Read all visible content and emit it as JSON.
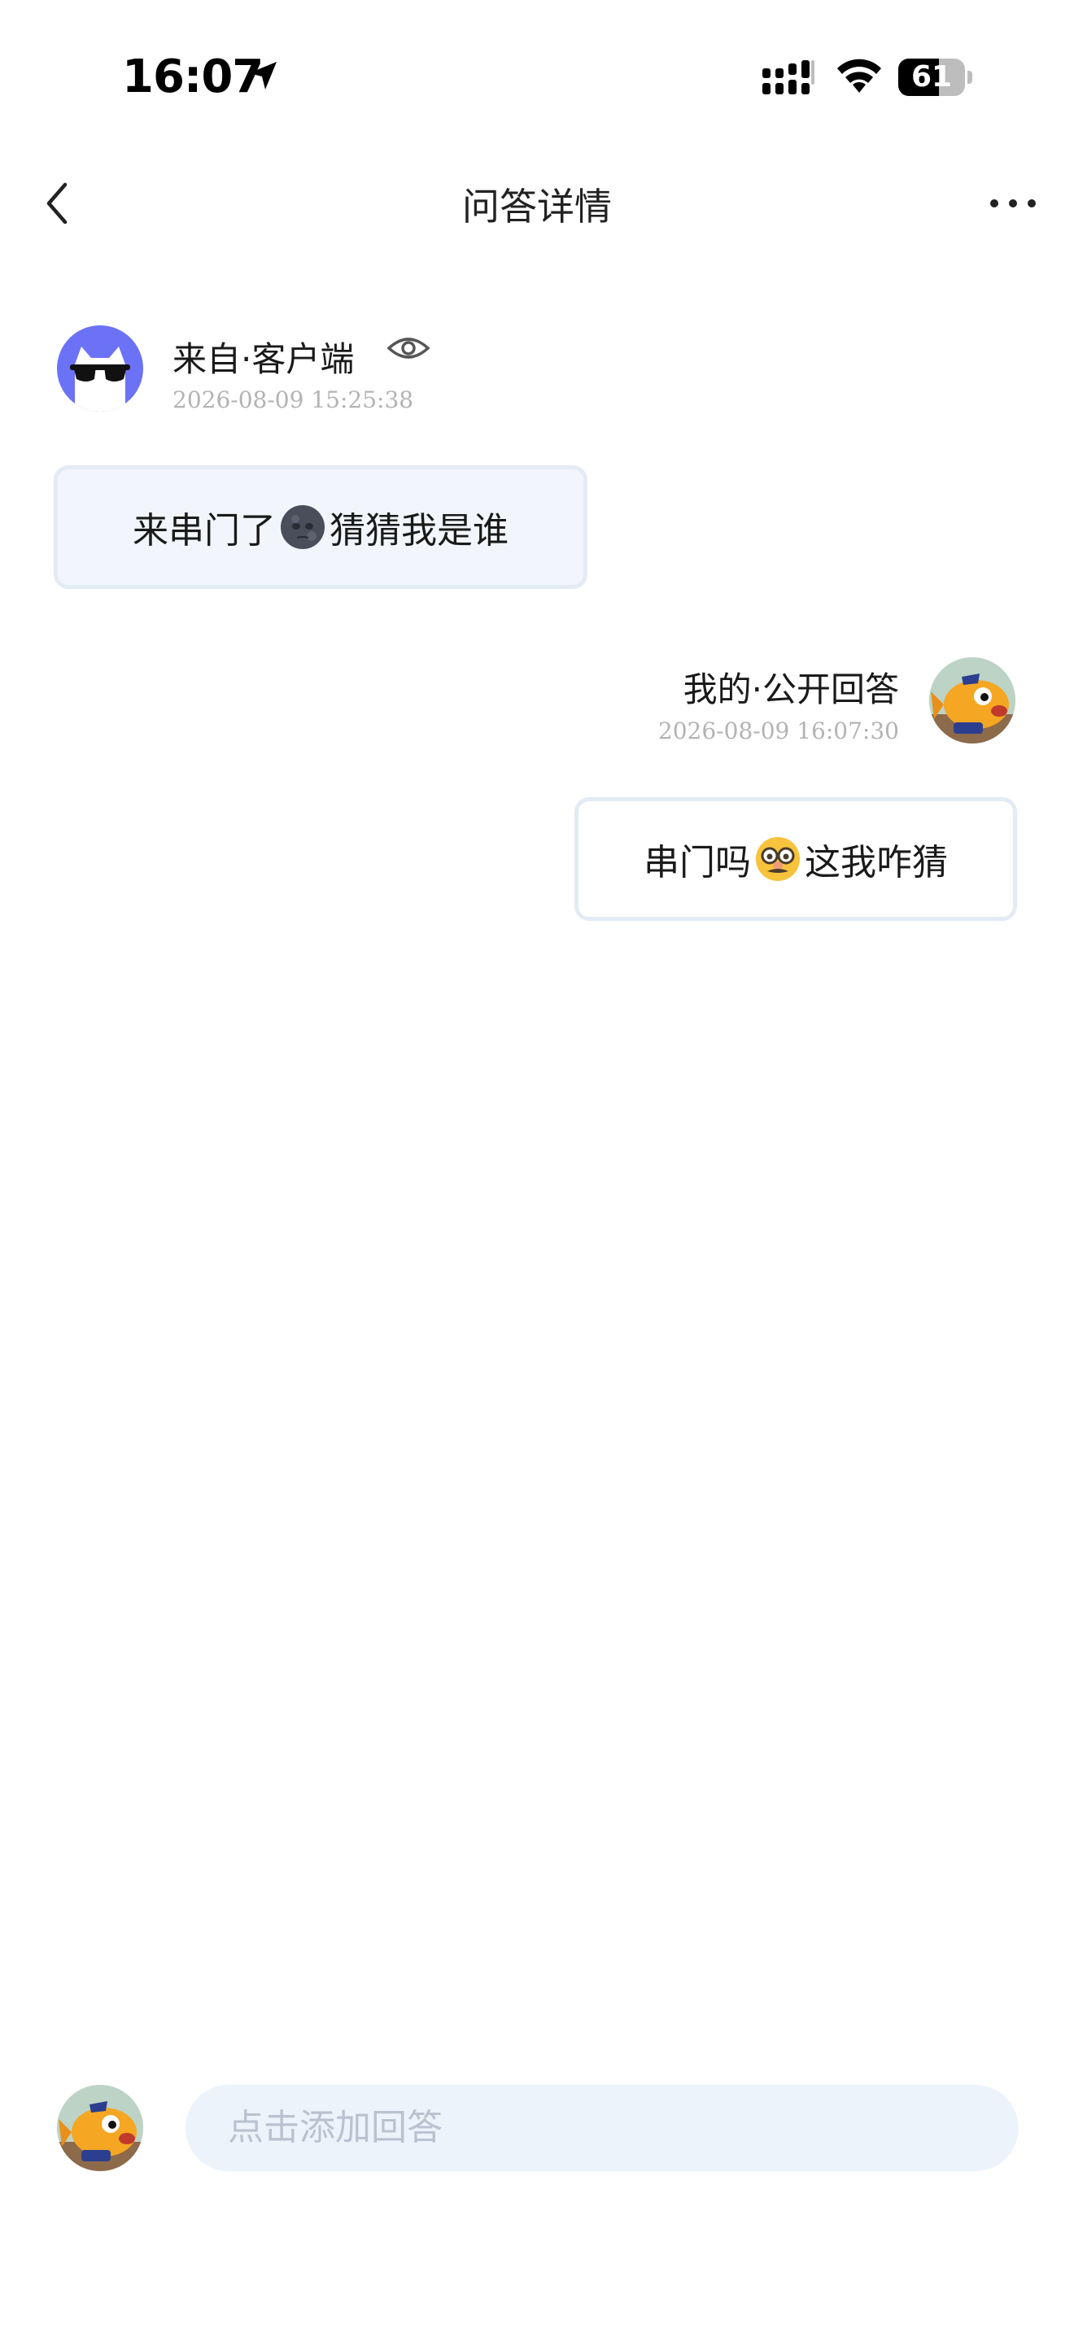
{
  "status_bar": {
    "time": "16:07",
    "battery_level": "61",
    "battery_fraction": 0.61
  },
  "nav": {
    "title": "问答详情"
  },
  "question": {
    "sender": "来自·客户端",
    "time": "2026-08-09 15:25:38",
    "text_before_emoji": "来串门了",
    "emoji": "new-moon-face-emoji",
    "text_after_emoji": " 猜猜我是谁"
  },
  "answer": {
    "sender": "我的·公开回答",
    "time": "2026-08-09 16:07:30",
    "text_before_emoji": "串门吗",
    "emoji": "disguised-face-emoji",
    "text_after_emoji": "这我咋猜"
  },
  "reply": {
    "placeholder": "点击添加回答"
  },
  "colors": {
    "incoming_bubble": "#f2f6fc",
    "bubble_border": "#e4ebf4",
    "input_background": "#edf3fb",
    "asker_avatar_bg": "#6b72f5"
  }
}
